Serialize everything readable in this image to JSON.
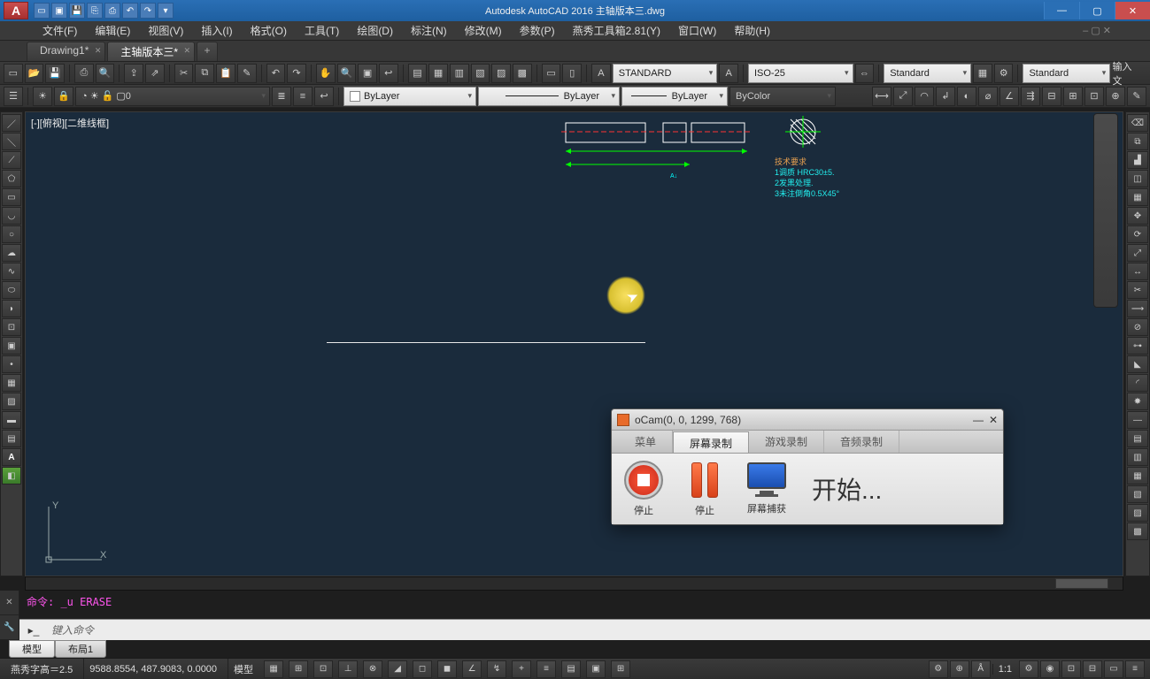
{
  "titlebar": {
    "app_title": "Autodesk AutoCAD 2016   主轴版本三.dwg",
    "app_logo": "A"
  },
  "menubar": {
    "items": [
      "文件(F)",
      "编辑(E)",
      "视图(V)",
      "插入(I)",
      "格式(O)",
      "工具(T)",
      "绘图(D)",
      "标注(N)",
      "修改(M)",
      "参数(P)",
      "燕秀工具箱2.81(Y)",
      "窗口(W)",
      "帮助(H)"
    ],
    "right_symbol": "– ▢ ✕"
  },
  "doctabs": {
    "tabs": [
      "Drawing1*",
      "主轴版本三*"
    ],
    "active_index": 1
  },
  "toolbar": {
    "text_style": "STANDARD",
    "dim_style": "ISO-25",
    "table_style": "Standard",
    "mline_style": "Standard",
    "row_end": "输入文",
    "layer_combo": "0",
    "color_combo": "ByLayer",
    "linetype_combo": "ByLayer",
    "lineweight_combo": "ByLayer",
    "plotstyle_combo": "ByColor"
  },
  "viewport": {
    "view_label": "[-][俯视][二维线框]",
    "tech_req_title": "技术要求",
    "tech_req_1": "1调质 HRC30±5.",
    "tech_req_2": "2发黑处理.",
    "tech_req_3": "3未注倒角0.5X45°"
  },
  "command": {
    "history": "命令:  _u  ERASE",
    "prompt": "键入命令"
  },
  "layout_tabs": {
    "tabs": [
      "模型",
      "布局1"
    ],
    "active_index": 0
  },
  "statusbar": {
    "left_label": "燕秀字高＝2.5",
    "coords": "9588.8554, 487.9083, 0.0000",
    "mode_label": "模型",
    "scale": "1:1"
  },
  "ocam": {
    "title": "oCam(0, 0, 1299, 768)",
    "tabs": [
      "菜单",
      "屏幕录制",
      "游戏录制",
      "音频录制"
    ],
    "active_tab": 1,
    "btn_stop": "停止",
    "btn_pause": "停止",
    "btn_capture": "屏幕捕获",
    "start_text": "开始..."
  }
}
